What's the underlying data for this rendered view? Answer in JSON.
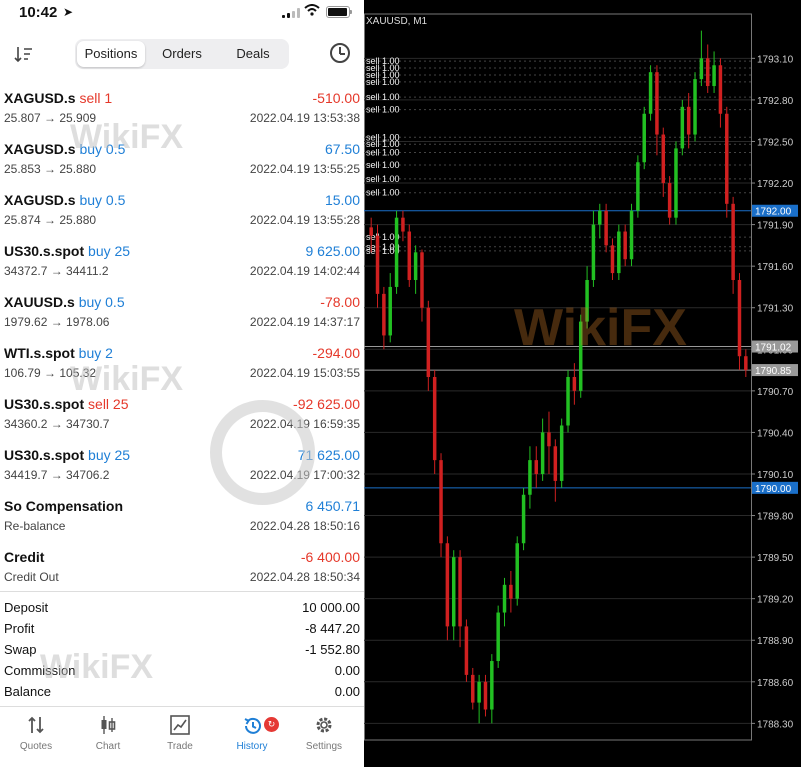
{
  "status_bar": {
    "time": "10:42",
    "location_icon": "location-arrow-icon",
    "signal_icon": "signal-icon",
    "wifi_icon": "wifi-icon",
    "battery_icon": "battery-icon"
  },
  "toolbar": {
    "sort_icon": "sort-icon",
    "tabs": [
      "Positions",
      "Orders",
      "Deals"
    ],
    "active_tab": "Positions",
    "history_icon": "clock-icon"
  },
  "colors": {
    "sell": "#e5382a",
    "buy": "#1f7fd6",
    "accent": "#1f7fd6",
    "chart_bg": "#000000",
    "bull": "#22c022",
    "bear": "#d02020"
  },
  "deals": [
    {
      "symbol": "XAGUSD.s",
      "type": "sell 1",
      "side": "sell",
      "profit": "-510.00",
      "price": "25.807 → 25.909",
      "time": "2022.04.19 13:53:38"
    },
    {
      "symbol": "XAGUSD.s",
      "type": "buy 0.5",
      "side": "buy",
      "profit": "67.50",
      "price": "25.853 → 25.880",
      "time": "2022.04.19 13:55:25"
    },
    {
      "symbol": "XAGUSD.s",
      "type": "buy 0.5",
      "side": "buy",
      "profit": "15.00",
      "price": "25.874 → 25.880",
      "time": "2022.04.19 13:55:28"
    },
    {
      "symbol": "US30.s.spot",
      "type": "buy 25",
      "side": "buy",
      "profit": "9 625.00",
      "price": "34372.7 → 34411.2",
      "time": "2022.04.19 14:02:44"
    },
    {
      "symbol": "XAUUSD.s",
      "type": "buy 0.5",
      "side": "buy",
      "profit": "-78.00",
      "price": "1979.62 → 1978.06",
      "time": "2022.04.19 14:37:17"
    },
    {
      "symbol": "WTI.s.spot",
      "type": "buy 2",
      "side": "buy",
      "profit": "-294.00",
      "price": "106.79 → 105.32",
      "time": "2022.04.19 15:03:55"
    },
    {
      "symbol": "US30.s.spot",
      "type": "sell 25",
      "side": "sell",
      "profit": "-92 625.00",
      "price": "34360.2 → 34730.7",
      "time": "2022.04.19 16:59:35"
    },
    {
      "symbol": "US30.s.spot",
      "type": "buy 25",
      "side": "buy",
      "profit": "71 625.00",
      "price": "34419.7 → 34706.2",
      "time": "2022.04.19 17:00:32"
    },
    {
      "symbol": "So Compensation",
      "type": "",
      "side": "",
      "profit": "6 450.71",
      "price": "Re-balance",
      "time": "2022.04.28 18:50:16"
    },
    {
      "symbol": "Credit",
      "type": "",
      "side": "",
      "profit": "-6 400.00",
      "price": "Credit Out",
      "time": "2022.04.28 18:50:34"
    }
  ],
  "summary": [
    {
      "label": "Deposit",
      "value": "10 000.00"
    },
    {
      "label": "Profit",
      "value": "-8 447.20"
    },
    {
      "label": "Swap",
      "value": "-1 552.80"
    },
    {
      "label": "Commission",
      "value": "0.00"
    },
    {
      "label": "Balance",
      "value": "0.00"
    }
  ],
  "bottom_nav": [
    {
      "label": "Quotes",
      "icon": "quotes-arrows-icon"
    },
    {
      "label": "Chart",
      "icon": "candlestick-icon"
    },
    {
      "label": "Trade",
      "icon": "trend-chart-icon"
    },
    {
      "label": "History",
      "icon": "history-clock-icon",
      "badge": "↻"
    },
    {
      "label": "Settings",
      "icon": "gear-icon"
    }
  ],
  "active_nav": "History",
  "watermark": "WikiFX",
  "chart_data": {
    "type": "candlestick",
    "title": "XAUUSD, M1",
    "y_ticks": [
      "1793.10",
      "1792.80",
      "1792.50",
      "1792.20",
      "1791.90",
      "1791.60",
      "1791.30",
      "1791.00",
      "1790.70",
      "1790.40",
      "1790.10",
      "1789.80",
      "1789.50",
      "1789.20",
      "1788.90",
      "1788.60",
      "1788.30"
    ],
    "ylim": [
      1788.18,
      1793.42
    ],
    "price_labels": [
      {
        "value": 1792.0,
        "text": "1792.00",
        "color": "#1a6fc9",
        "line": "solid"
      },
      {
        "value": 1791.02,
        "text": "1791.02",
        "color": "#999999",
        "line": "solid"
      },
      {
        "value": 1790.85,
        "text": "1790.85",
        "color": "#999999",
        "line": "solid"
      },
      {
        "value": 1790.0,
        "text": "1790.00",
        "color": "#1a6fc9",
        "line": "solid"
      }
    ],
    "order_lines": [
      {
        "value": 1793.08,
        "text": "sell 1.00"
      },
      {
        "value": 1793.03,
        "text": "sell 1.00"
      },
      {
        "value": 1792.98,
        "text": "sell 1.00"
      },
      {
        "value": 1792.93,
        "text": "sell 1.00"
      },
      {
        "value": 1792.82,
        "text": "sell 1.00"
      },
      {
        "value": 1792.73,
        "text": "sell 1.00"
      },
      {
        "value": 1792.53,
        "text": "sell 1.00"
      },
      {
        "value": 1792.48,
        "text": "sell 1.00"
      },
      {
        "value": 1792.42,
        "text": "sell 1.00"
      },
      {
        "value": 1792.33,
        "text": "sell 1.00"
      },
      {
        "value": 1792.23,
        "text": "sell 1.00"
      },
      {
        "value": 1792.13,
        "text": "sell 1.00"
      },
      {
        "value": 1791.81,
        "text": "sell 1.00"
      },
      {
        "value": 1791.74,
        "text": "sell 1.00"
      },
      {
        "value": 1791.71,
        "text": "sell 1.00"
      }
    ],
    "candles": [
      [
        1791.88,
        1791.82,
        1791.95,
        1791.7
      ],
      [
        1791.82,
        1791.4,
        1791.9,
        1791.3
      ],
      [
        1791.4,
        1791.1,
        1791.45,
        1791.0
      ],
      [
        1791.1,
        1791.45,
        1791.55,
        1791.05
      ],
      [
        1791.45,
        1791.95,
        1792.0,
        1791.4
      ],
      [
        1791.95,
        1791.85,
        1792.0,
        1791.78
      ],
      [
        1791.85,
        1791.5,
        1791.9,
        1791.45
      ],
      [
        1791.5,
        1791.7,
        1791.75,
        1791.4
      ],
      [
        1791.7,
        1791.3,
        1791.72,
        1791.2
      ],
      [
        1791.3,
        1790.8,
        1791.35,
        1790.7
      ],
      [
        1790.8,
        1790.2,
        1790.85,
        1790.1
      ],
      [
        1790.2,
        1789.6,
        1790.25,
        1789.5
      ],
      [
        1789.6,
        1789.0,
        1789.65,
        1788.9
      ],
      [
        1789.0,
        1789.5,
        1789.55,
        1788.9
      ],
      [
        1789.5,
        1789.0,
        1789.55,
        1788.85
      ],
      [
        1789.0,
        1788.65,
        1789.05,
        1788.6
      ],
      [
        1788.65,
        1788.45,
        1788.7,
        1788.4
      ],
      [
        1788.45,
        1788.6,
        1788.65,
        1788.3
      ],
      [
        1788.6,
        1788.4,
        1788.65,
        1788.35
      ],
      [
        1788.4,
        1788.75,
        1788.8,
        1788.3
      ],
      [
        1788.75,
        1789.1,
        1789.15,
        1788.7
      ],
      [
        1789.1,
        1789.3,
        1789.35,
        1789.0
      ],
      [
        1789.3,
        1789.2,
        1789.4,
        1789.1
      ],
      [
        1789.2,
        1789.6,
        1789.65,
        1789.15
      ],
      [
        1789.6,
        1789.95,
        1790.0,
        1789.55
      ],
      [
        1789.95,
        1790.2,
        1790.3,
        1789.85
      ],
      [
        1790.2,
        1790.1,
        1790.3,
        1790.0
      ],
      [
        1790.1,
        1790.4,
        1790.5,
        1790.05
      ],
      [
        1790.4,
        1790.3,
        1790.55,
        1790.1
      ],
      [
        1790.3,
        1790.05,
        1790.35,
        1789.9
      ],
      [
        1790.05,
        1790.45,
        1790.5,
        1790.0
      ],
      [
        1790.45,
        1790.8,
        1790.85,
        1790.4
      ],
      [
        1790.8,
        1790.7,
        1790.9,
        1790.6
      ],
      [
        1790.7,
        1791.2,
        1791.25,
        1790.65
      ],
      [
        1791.2,
        1791.5,
        1791.6,
        1791.15
      ],
      [
        1791.5,
        1791.9,
        1792.0,
        1791.45
      ],
      [
        1791.9,
        1792.0,
        1792.05,
        1791.8
      ],
      [
        1792.0,
        1791.75,
        1792.05,
        1791.7
      ],
      [
        1791.75,
        1791.55,
        1791.8,
        1791.5
      ],
      [
        1791.55,
        1791.85,
        1791.9,
        1791.5
      ],
      [
        1791.85,
        1791.65,
        1791.9,
        1791.6
      ],
      [
        1791.65,
        1792.0,
        1792.05,
        1791.6
      ],
      [
        1792.0,
        1792.35,
        1792.4,
        1791.95
      ],
      [
        1792.35,
        1792.7,
        1792.75,
        1792.3
      ],
      [
        1792.7,
        1793.0,
        1793.05,
        1792.65
      ],
      [
        1793.0,
        1792.55,
        1793.05,
        1792.4
      ],
      [
        1792.55,
        1792.2,
        1792.6,
        1792.1
      ],
      [
        1792.2,
        1791.95,
        1792.25,
        1791.9
      ],
      [
        1791.95,
        1792.45,
        1792.5,
        1791.9
      ],
      [
        1792.45,
        1792.75,
        1792.8,
        1792.4
      ],
      [
        1792.75,
        1792.55,
        1792.85,
        1792.45
      ],
      [
        1792.55,
        1792.95,
        1793.0,
        1792.5
      ],
      [
        1792.95,
        1793.1,
        1793.3,
        1792.9
      ],
      [
        1793.1,
        1792.9,
        1793.2,
        1792.85
      ],
      [
        1792.9,
        1793.05,
        1793.15,
        1792.85
      ],
      [
        1793.05,
        1792.7,
        1793.1,
        1792.6
      ],
      [
        1792.7,
        1792.05,
        1792.75,
        1791.95
      ],
      [
        1792.05,
        1791.5,
        1792.1,
        1791.4
      ],
      [
        1791.5,
        1790.95,
        1791.55,
        1790.85
      ],
      [
        1790.95,
        1790.85,
        1791.0,
        1790.8
      ]
    ]
  }
}
